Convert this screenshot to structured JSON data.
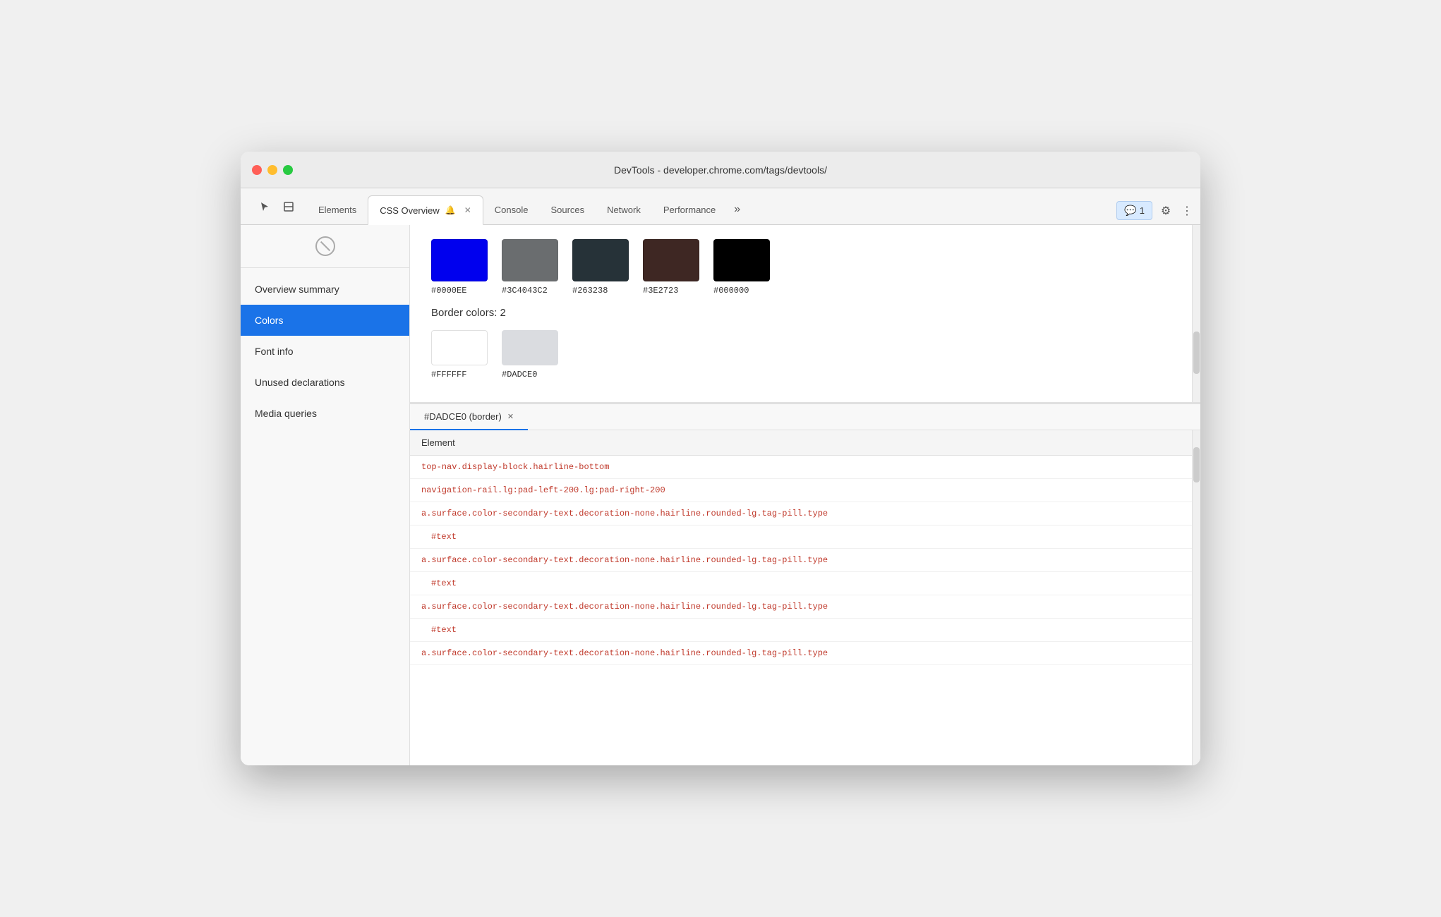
{
  "window": {
    "title": "DevTools - developer.chrome.com/tags/devtools/"
  },
  "tabs": {
    "items": [
      {
        "label": "Elements",
        "active": false,
        "closeable": false
      },
      {
        "label": "CSS Overview",
        "active": true,
        "closeable": true,
        "bell": true
      },
      {
        "label": "Console",
        "active": false,
        "closeable": false
      },
      {
        "label": "Sources",
        "active": false,
        "closeable": false
      },
      {
        "label": "Network",
        "active": false,
        "closeable": false
      },
      {
        "label": "Performance",
        "active": false,
        "closeable": false
      }
    ],
    "more_label": "»",
    "feedback_badge": "1",
    "feedback_label": "1"
  },
  "sidebar": {
    "items": [
      {
        "label": "Overview summary",
        "active": false
      },
      {
        "label": "Colors",
        "active": true
      },
      {
        "label": "Font info",
        "active": false
      },
      {
        "label": "Unused declarations",
        "active": false
      },
      {
        "label": "Media queries",
        "active": false
      }
    ]
  },
  "colors_panel": {
    "text_colors_section": {
      "title": "Border colors: 2",
      "swatches": [
        {
          "hex": "#FFFFFF",
          "bg": "#FFFFFF",
          "border": true
        },
        {
          "hex": "#DADCE0",
          "bg": "#DADCE0",
          "border": false
        }
      ]
    },
    "background_swatches": [
      {
        "hex": "#0000EE",
        "bg": "#0000EE"
      },
      {
        "hex": "#3C4043C2",
        "bg": "#3C4043"
      },
      {
        "hex": "#263238",
        "bg": "#263238"
      },
      {
        "hex": "#3E2723",
        "bg": "#3E2723"
      },
      {
        "hex": "#000000",
        "bg": "#000000"
      }
    ]
  },
  "element_panel": {
    "tab_label": "#DADCE0 (border)",
    "table_header": "Element",
    "rows": [
      {
        "text": "top-nav.display-block.hairline-bottom",
        "type": "selector"
      },
      {
        "text": "navigation-rail.lg:pad-left-200.lg:pad-right-200",
        "type": "selector"
      },
      {
        "text": "a.surface.color-secondary-text.decoration-none.hairline.rounded-lg.tag-pill.type",
        "type": "selector"
      },
      {
        "text": "#text",
        "type": "text-node"
      },
      {
        "text": "a.surface.color-secondary-text.decoration-none.hairline.rounded-lg.tag-pill.type",
        "type": "selector"
      },
      {
        "text": "#text",
        "type": "text-node"
      },
      {
        "text": "a.surface.color-secondary-text.decoration-none.hairline.rounded-lg.tag-pill.type",
        "type": "selector"
      },
      {
        "text": "#text",
        "type": "text-node"
      },
      {
        "text": "a.surface.color-secondary-text.decoration-none.hairline.rounded-lg.tag-pill.type",
        "type": "selector"
      }
    ]
  }
}
